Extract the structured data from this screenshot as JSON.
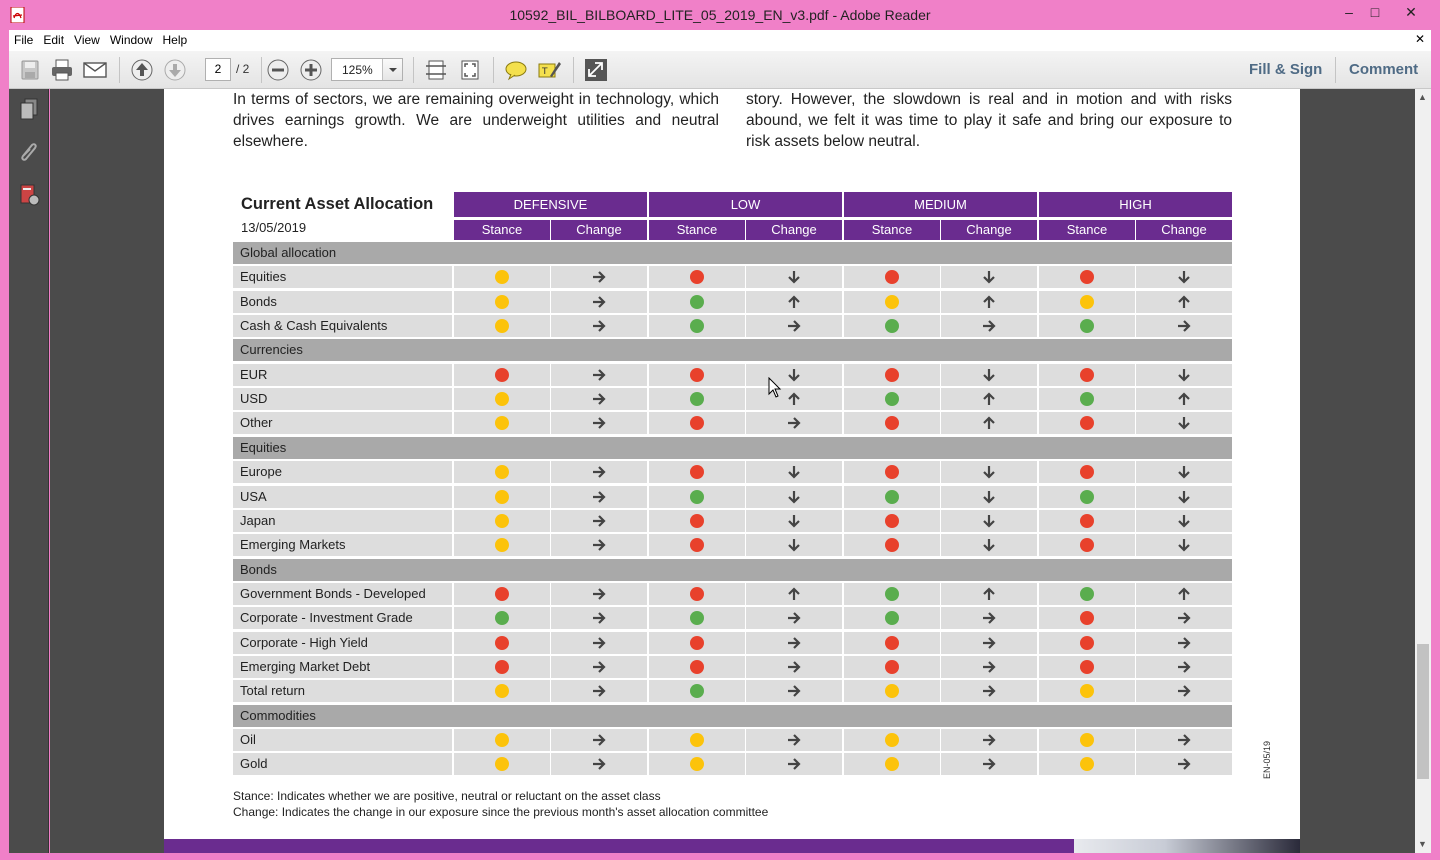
{
  "window": {
    "title": "10592_BIL_BILBOARD_LITE_05_2019_EN_v3.pdf - Adobe Reader",
    "minimize": "–",
    "maximize": "□",
    "close": "✕"
  },
  "menu": [
    "File",
    "Edit",
    "View",
    "Window",
    "Help"
  ],
  "menu_close": "✕",
  "toolbar": {
    "page_current": "2",
    "page_total": "/ 2",
    "zoom": "125%",
    "fill_sign": "Fill & Sign",
    "comment": "Comment",
    "icons": [
      "save-icon",
      "print-icon",
      "email-icon",
      "prev-page-icon",
      "next-page-icon",
      "zoom-out-icon",
      "zoom-in-icon",
      "fit-page-icon",
      "fit-width-icon",
      "comment-bubble-icon",
      "highlight-icon",
      "fullscreen-icon"
    ]
  },
  "nav_panel_icons": [
    "pages-icon",
    "attachments-icon",
    "document-info-icon"
  ],
  "doc": {
    "para_left": "In terms of sectors, we are remaining overweight in technology, which drives earnings growth. We are underweight utilities and neutral elsewhere.",
    "para_right": "story. However, the slowdown is real and in motion and with risks abound, we felt it was time to play it safe and bring our exposure to risk assets below neutral.",
    "table_title": "Current Asset Allocation",
    "table_date": "13/05/2019",
    "groups": [
      "DEFENSIVE",
      "LOW",
      "MEDIUM",
      "HIGH"
    ],
    "sub_headers": [
      "Stance",
      "Change"
    ],
    "colors": {
      "green": "#5aad4e",
      "yellow": "#fcc30b",
      "red": "#e8412c",
      "purple": "#6a2c8f"
    },
    "sections": [
      {
        "name": "Global allocation",
        "rows": [
          {
            "label": "Equities",
            "cells": [
              "yellow",
              "right",
              "red",
              "down",
              "red",
              "down",
              "red",
              "down"
            ]
          },
          {
            "label": "Bonds",
            "cells": [
              "yellow",
              "right",
              "green",
              "up",
              "yellow",
              "up",
              "yellow",
              "up"
            ]
          },
          {
            "label": "Cash & Cash Equivalents",
            "cells": [
              "yellow",
              "right",
              "green",
              "right",
              "green",
              "right",
              "green",
              "right"
            ]
          }
        ]
      },
      {
        "name": "Currencies",
        "rows": [
          {
            "label": "EUR",
            "cells": [
              "red",
              "right",
              "red",
              "down",
              "red",
              "down",
              "red",
              "down"
            ]
          },
          {
            "label": "USD",
            "cells": [
              "yellow",
              "right",
              "green",
              "up",
              "green",
              "up",
              "green",
              "up"
            ]
          },
          {
            "label": "Other",
            "cells": [
              "yellow",
              "right",
              "red",
              "right",
              "red",
              "up",
              "red",
              "down"
            ]
          }
        ]
      },
      {
        "name": "Equities",
        "rows": [
          {
            "label": "Europe",
            "cells": [
              "yellow",
              "right",
              "red",
              "down",
              "red",
              "down",
              "red",
              "down"
            ]
          },
          {
            "label": "USA",
            "cells": [
              "yellow",
              "right",
              "green",
              "down",
              "green",
              "down",
              "green",
              "down"
            ]
          },
          {
            "label": "Japan",
            "cells": [
              "yellow",
              "right",
              "red",
              "down",
              "red",
              "down",
              "red",
              "down"
            ]
          },
          {
            "label": "Emerging Markets",
            "cells": [
              "yellow",
              "right",
              "red",
              "down",
              "red",
              "down",
              "red",
              "down"
            ]
          }
        ]
      },
      {
        "name": "Bonds",
        "rows": [
          {
            "label": "Government Bonds - Developed",
            "cells": [
              "red",
              "right",
              "red",
              "up",
              "green",
              "up",
              "green",
              "up"
            ]
          },
          {
            "label": "Corporate - Investment Grade",
            "cells": [
              "green",
              "right",
              "green",
              "right",
              "green",
              "right",
              "red",
              "right"
            ]
          },
          {
            "label": "Corporate - High Yield",
            "cells": [
              "red",
              "right",
              "red",
              "right",
              "red",
              "right",
              "red",
              "right"
            ]
          },
          {
            "label": "Emerging Market Debt",
            "cells": [
              "red",
              "right",
              "red",
              "right",
              "red",
              "right",
              "red",
              "right"
            ]
          },
          {
            "label": "Total return",
            "cells": [
              "yellow",
              "right",
              "green",
              "right",
              "yellow",
              "right",
              "yellow",
              "right"
            ]
          }
        ]
      },
      {
        "name": "Commodities",
        "rows": [
          {
            "label": "Oil",
            "cells": [
              "yellow",
              "right",
              "yellow",
              "right",
              "yellow",
              "right",
              "yellow",
              "right"
            ]
          },
          {
            "label": "Gold",
            "cells": [
              "yellow",
              "right",
              "yellow",
              "right",
              "yellow",
              "right",
              "yellow",
              "right"
            ]
          }
        ]
      }
    ],
    "footnote_stance": "Stance: Indicates whether we are positive, neutral or reluctant on the asset class",
    "footnote_change": "Change: Indicates the change in our exposure since the previous month's asset allocation committee",
    "doc_code": "EN-05/19"
  }
}
